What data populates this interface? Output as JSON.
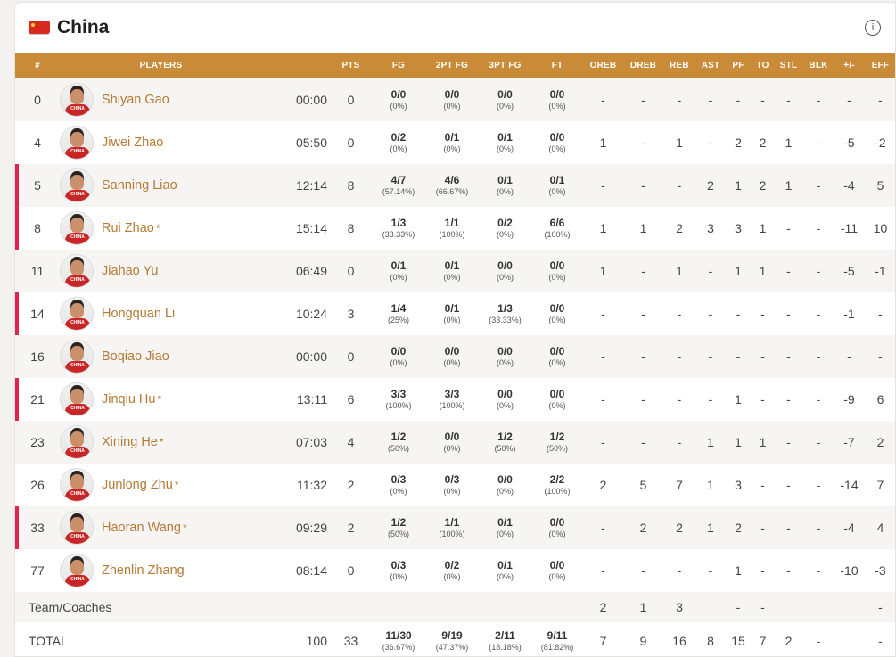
{
  "team": {
    "name": "China",
    "flag_icon": "china-flag-icon"
  },
  "header": {
    "info_icon": "info-icon"
  },
  "columns": [
    "#",
    "PLAYERS",
    "",
    "PTS",
    "FG",
    "2PT FG",
    "3PT FG",
    "FT",
    "OREB",
    "DREB",
    "REB",
    "AST",
    "PF",
    "TO",
    "STL",
    "BLK",
    "+/-",
    "EFF"
  ],
  "players": [
    {
      "num": "0",
      "name": "Shiyan Gao",
      "star": false,
      "active": false,
      "min": "00:00",
      "pts": "0",
      "fg": [
        "0/0",
        "(0%)"
      ],
      "fg2": [
        "0/0",
        "(0%)"
      ],
      "fg3": [
        "0/0",
        "(0%)"
      ],
      "ft": [
        "0/0",
        "(0%)"
      ],
      "oreb": "-",
      "dreb": "-",
      "reb": "-",
      "ast": "-",
      "pf": "-",
      "to": "-",
      "stl": "-",
      "blk": "-",
      "pm": "-",
      "eff": "-"
    },
    {
      "num": "4",
      "name": "Jiwei Zhao",
      "star": false,
      "active": false,
      "min": "05:50",
      "pts": "0",
      "fg": [
        "0/2",
        "(0%)"
      ],
      "fg2": [
        "0/1",
        "(0%)"
      ],
      "fg3": [
        "0/1",
        "(0%)"
      ],
      "ft": [
        "0/0",
        "(0%)"
      ],
      "oreb": "1",
      "dreb": "-",
      "reb": "1",
      "ast": "-",
      "pf": "2",
      "to": "2",
      "stl": "1",
      "blk": "-",
      "pm": "-5",
      "eff": "-2"
    },
    {
      "num": "5",
      "name": "Sanning Liao",
      "star": false,
      "active": true,
      "min": "12:14",
      "pts": "8",
      "fg": [
        "4/7",
        "(57.14%)"
      ],
      "fg2": [
        "4/6",
        "(66.67%)"
      ],
      "fg3": [
        "0/1",
        "(0%)"
      ],
      "ft": [
        "0/1",
        "(0%)"
      ],
      "oreb": "-",
      "dreb": "-",
      "reb": "-",
      "ast": "2",
      "pf": "1",
      "to": "2",
      "stl": "1",
      "blk": "-",
      "pm": "-4",
      "eff": "5"
    },
    {
      "num": "8",
      "name": "Rui Zhao",
      "star": true,
      "active": true,
      "min": "15:14",
      "pts": "8",
      "fg": [
        "1/3",
        "(33.33%)"
      ],
      "fg2": [
        "1/1",
        "(100%)"
      ],
      "fg3": [
        "0/2",
        "(0%)"
      ],
      "ft": [
        "6/6",
        "(100%)"
      ],
      "oreb": "1",
      "dreb": "1",
      "reb": "2",
      "ast": "3",
      "pf": "3",
      "to": "1",
      "stl": "-",
      "blk": "-",
      "pm": "-11",
      "eff": "10"
    },
    {
      "num": "11",
      "name": "Jiahao Yu",
      "star": false,
      "active": false,
      "min": "06:49",
      "pts": "0",
      "fg": [
        "0/1",
        "(0%)"
      ],
      "fg2": [
        "0/1",
        "(0%)"
      ],
      "fg3": [
        "0/0",
        "(0%)"
      ],
      "ft": [
        "0/0",
        "(0%)"
      ],
      "oreb": "1",
      "dreb": "-",
      "reb": "1",
      "ast": "-",
      "pf": "1",
      "to": "1",
      "stl": "-",
      "blk": "-",
      "pm": "-5",
      "eff": "-1"
    },
    {
      "num": "14",
      "name": "Hongquan Li",
      "star": false,
      "active": true,
      "min": "10:24",
      "pts": "3",
      "fg": [
        "1/4",
        "(25%)"
      ],
      "fg2": [
        "0/1",
        "(0%)"
      ],
      "fg3": [
        "1/3",
        "(33.33%)"
      ],
      "ft": [
        "0/0",
        "(0%)"
      ],
      "oreb": "-",
      "dreb": "-",
      "reb": "-",
      "ast": "-",
      "pf": "-",
      "to": "-",
      "stl": "-",
      "blk": "-",
      "pm": "-1",
      "eff": "-"
    },
    {
      "num": "16",
      "name": "Boqiao Jiao",
      "star": false,
      "active": false,
      "min": "00:00",
      "pts": "0",
      "fg": [
        "0/0",
        "(0%)"
      ],
      "fg2": [
        "0/0",
        "(0%)"
      ],
      "fg3": [
        "0/0",
        "(0%)"
      ],
      "ft": [
        "0/0",
        "(0%)"
      ],
      "oreb": "-",
      "dreb": "-",
      "reb": "-",
      "ast": "-",
      "pf": "-",
      "to": "-",
      "stl": "-",
      "blk": "-",
      "pm": "-",
      "eff": "-"
    },
    {
      "num": "21",
      "name": "Jinqiu Hu",
      "star": true,
      "active": true,
      "min": "13:11",
      "pts": "6",
      "fg": [
        "3/3",
        "(100%)"
      ],
      "fg2": [
        "3/3",
        "(100%)"
      ],
      "fg3": [
        "0/0",
        "(0%)"
      ],
      "ft": [
        "0/0",
        "(0%)"
      ],
      "oreb": "-",
      "dreb": "-",
      "reb": "-",
      "ast": "-",
      "pf": "1",
      "to": "-",
      "stl": "-",
      "blk": "-",
      "pm": "-9",
      "eff": "6"
    },
    {
      "num": "23",
      "name": "Xining He",
      "star": true,
      "active": false,
      "min": "07:03",
      "pts": "4",
      "fg": [
        "1/2",
        "(50%)"
      ],
      "fg2": [
        "0/0",
        "(0%)"
      ],
      "fg3": [
        "1/2",
        "(50%)"
      ],
      "ft": [
        "1/2",
        "(50%)"
      ],
      "oreb": "-",
      "dreb": "-",
      "reb": "-",
      "ast": "1",
      "pf": "1",
      "to": "1",
      "stl": "-",
      "blk": "-",
      "pm": "-7",
      "eff": "2"
    },
    {
      "num": "26",
      "name": "Junlong Zhu",
      "star": true,
      "active": false,
      "min": "11:32",
      "pts": "2",
      "fg": [
        "0/3",
        "(0%)"
      ],
      "fg2": [
        "0/3",
        "(0%)"
      ],
      "fg3": [
        "0/0",
        "(0%)"
      ],
      "ft": [
        "2/2",
        "(100%)"
      ],
      "oreb": "2",
      "dreb": "5",
      "reb": "7",
      "ast": "1",
      "pf": "3",
      "to": "-",
      "stl": "-",
      "blk": "-",
      "pm": "-14",
      "eff": "7"
    },
    {
      "num": "33",
      "name": "Haoran Wang",
      "star": true,
      "active": true,
      "min": "09:29",
      "pts": "2",
      "fg": [
        "1/2",
        "(50%)"
      ],
      "fg2": [
        "1/1",
        "(100%)"
      ],
      "fg3": [
        "0/1",
        "(0%)"
      ],
      "ft": [
        "0/0",
        "(0%)"
      ],
      "oreb": "-",
      "dreb": "2",
      "reb": "2",
      "ast": "1",
      "pf": "2",
      "to": "-",
      "stl": "-",
      "blk": "-",
      "pm": "-4",
      "eff": "4"
    },
    {
      "num": "77",
      "name": "Zhenlin Zhang",
      "star": false,
      "active": false,
      "min": "08:14",
      "pts": "0",
      "fg": [
        "0/3",
        "(0%)"
      ],
      "fg2": [
        "0/2",
        "(0%)"
      ],
      "fg3": [
        "0/1",
        "(0%)"
      ],
      "ft": [
        "0/0",
        "(0%)"
      ],
      "oreb": "-",
      "dreb": "-",
      "reb": "-",
      "ast": "-",
      "pf": "1",
      "to": "-",
      "stl": "-",
      "blk": "-",
      "pm": "-10",
      "eff": "-3"
    }
  ],
  "team_row": {
    "label": "Team/Coaches",
    "oreb": "2",
    "dreb": "1",
    "reb": "3",
    "ast": "",
    "pf": "-",
    "to": "-",
    "stl": "",
    "blk": "",
    "pm": "",
    "eff": "-"
  },
  "total_row": {
    "label": "TOTAL",
    "min": "100",
    "pts": "33",
    "fg": [
      "11/30",
      "(36.67%)"
    ],
    "fg2": [
      "9/19",
      "(47.37%)"
    ],
    "fg3": [
      "2/11",
      "(18.18%)"
    ],
    "ft": [
      "9/11",
      "(81.82%)"
    ],
    "oreb": "7",
    "dreb": "9",
    "reb": "16",
    "ast": "8",
    "pf": "15",
    "to": "7",
    "stl": "2",
    "blk": "-",
    "pm": "",
    "eff": "-"
  },
  "colors": {
    "header_bg": "#c98b37",
    "active_marker": "#e0244e",
    "player_link": "#b57a34"
  }
}
